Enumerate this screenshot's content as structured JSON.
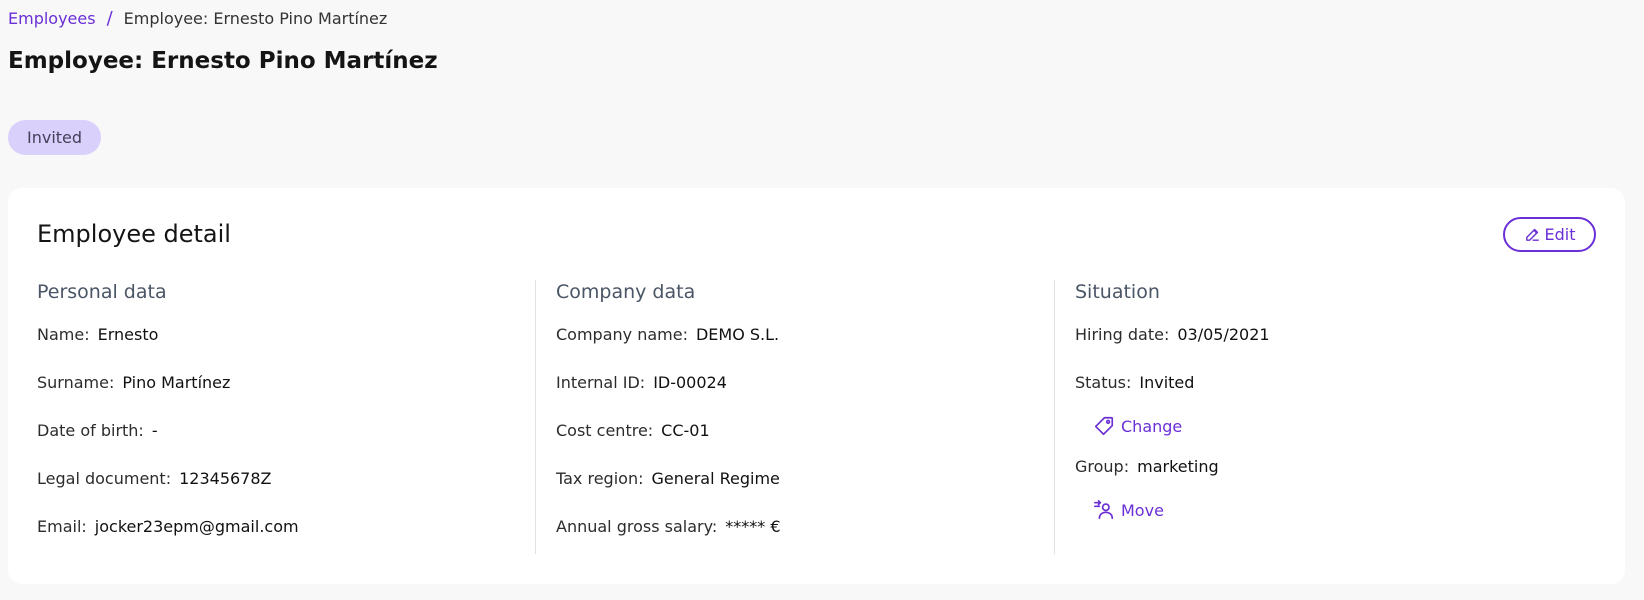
{
  "breadcrumb": {
    "root": "Employees",
    "separator": "/",
    "current": "Employee: Ernesto Pino Martínez"
  },
  "page_title": "Employee: Ernesto Pino Martínez",
  "status_chip": "Invited",
  "card": {
    "title": "Employee detail",
    "edit_label": "Edit"
  },
  "personal": {
    "title": "Personal data",
    "fields": [
      {
        "label": "Name:",
        "value": "Ernesto"
      },
      {
        "label": "Surname:",
        "value": "Pino Martínez"
      },
      {
        "label": "Date of birth:",
        "value": "-"
      },
      {
        "label": "Legal document:",
        "value": "12345678Z"
      },
      {
        "label": "Email:",
        "value": "jocker23epm@gmail.com"
      }
    ]
  },
  "company": {
    "title": "Company data",
    "fields": [
      {
        "label": "Company name:",
        "value": "DEMO S.L."
      },
      {
        "label": "Internal ID:",
        "value": "ID-00024"
      },
      {
        "label": "Cost centre:",
        "value": "CC-01"
      },
      {
        "label": "Tax region:",
        "value": "General Regime"
      },
      {
        "label": "Annual gross salary:",
        "value": "***** €"
      }
    ]
  },
  "situation": {
    "title": "Situation",
    "hiring_date": {
      "label": "Hiring date:",
      "value": "03/05/2021"
    },
    "status": {
      "label": "Status:",
      "value": "Invited"
    },
    "change_label": "Change",
    "group": {
      "label": "Group:",
      "value": "marketing"
    },
    "move_label": "Move"
  },
  "colors": {
    "accent": "#6a2fd6",
    "chip_bg": "#d9d0fb",
    "page_bg": "#f8f8f8",
    "card_bg": "#ffffff",
    "section_title": "#4a5566"
  },
  "icons": {
    "edit": "pencil-icon",
    "change": "tag-icon",
    "move": "user-move-icon"
  }
}
